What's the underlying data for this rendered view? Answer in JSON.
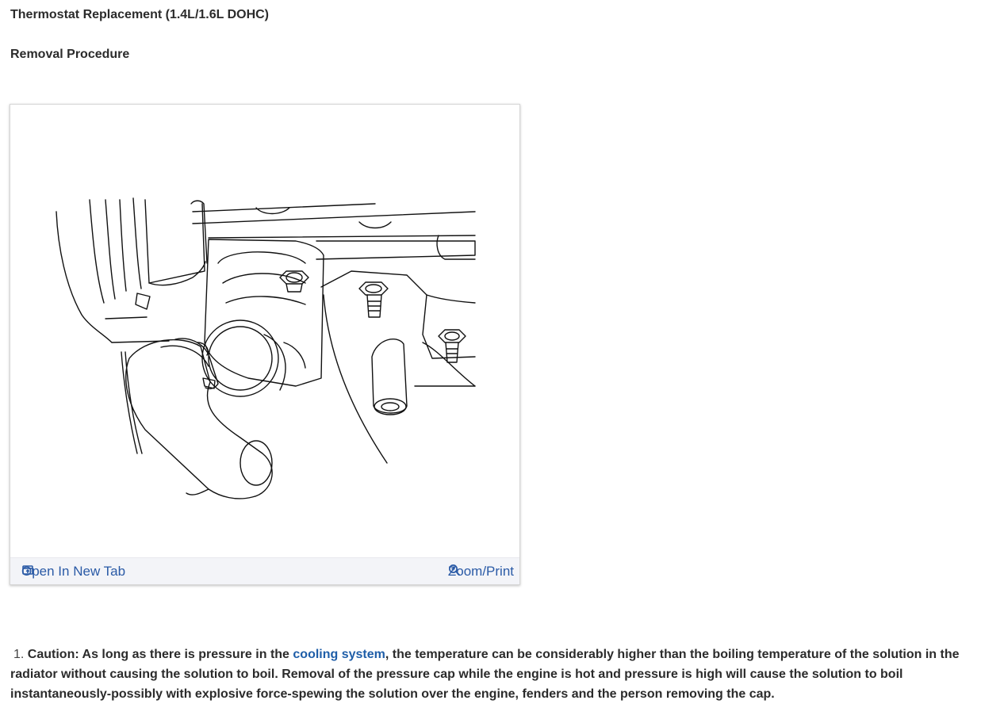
{
  "page": {
    "title": "Thermostat Replacement (1.4L/1.6L DOHC)",
    "subtitle": "Removal Procedure"
  },
  "figure": {
    "open_new_tab_label": "Open In New Tab",
    "open_new_tab_icon": "open-in-new-tab-icon",
    "zoom_print_label": "Zoom/Print",
    "zoom_print_icon": "zoom-in-icon",
    "link_color": "#2a5aa6"
  },
  "steps": [
    {
      "number": "1.",
      "caution_prefix": "Caution: As long as there is pressure in the ",
      "link_text": "cooling system",
      "caution_rest": ", the temperature can be considerably higher than the boiling temperature of the solution in the radiator without causing the solution to boil. Removal of the pressure cap while the engine is hot and pressure is high will cause the solution to boil instantaneously-possibly with explosive force-spewing the solution over the engine, fenders and the person removing the cap."
    }
  ]
}
